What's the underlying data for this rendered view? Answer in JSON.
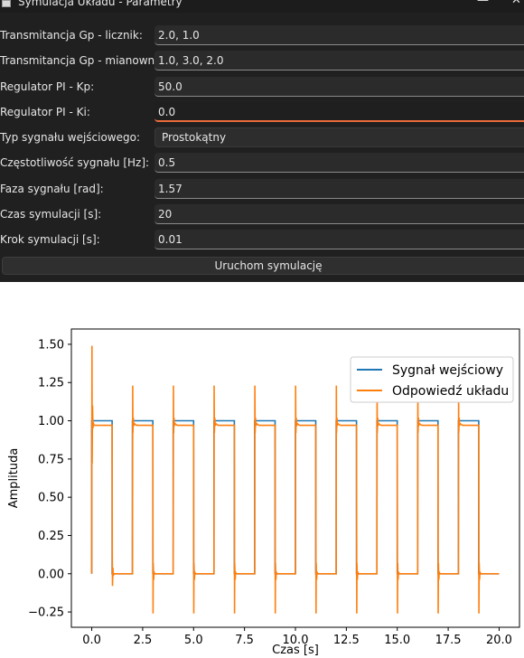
{
  "window": {
    "title": "Symulacja Układu - Parametry",
    "minimize_glyph": "—",
    "close_glyph": "✕"
  },
  "form": {
    "fields": [
      {
        "label": "Transmitancja Gp - licznik:",
        "value": "2.0, 1.0"
      },
      {
        "label": "Transmitancja Gp - mianownik:",
        "value": "1.0, 3.0, 2.0"
      },
      {
        "label": "Regulator PI - Kp:",
        "value": "50.0"
      },
      {
        "label": "Regulator PI - Ki:",
        "value": "0.0"
      },
      {
        "label": "Typ sygnału wejściowego:",
        "value": "Prostokątny"
      },
      {
        "label": "Częstotliwość sygnału [Hz]:",
        "value": "0.5"
      },
      {
        "label": "Faza sygnału [rad]:",
        "value": "1.57"
      },
      {
        "label": "Czas symulacji [s]:",
        "value": "20"
      },
      {
        "label": "Krok symulacji [s]:",
        "value": "0.01"
      }
    ],
    "run_button": "Uruchom symulację"
  },
  "chart_data": {
    "type": "line",
    "title": "",
    "xlabel": "Czas [s]",
    "ylabel": "Amplituda",
    "xlim": [
      -1.0,
      21.0
    ],
    "ylim": [
      -0.35,
      1.6
    ],
    "xticks": [
      0.0,
      2.5,
      5.0,
      7.5,
      10.0,
      12.5,
      15.0,
      17.5,
      20.0
    ],
    "xtick_labels": [
      "0.0",
      "2.5",
      "5.0",
      "7.5",
      "10.0",
      "12.5",
      "15.0",
      "17.5",
      "20.0"
    ],
    "yticks": [
      -0.25,
      0.0,
      0.25,
      0.5,
      0.75,
      1.0,
      1.25,
      1.5
    ],
    "ytick_labels": [
      "−0.25",
      "0.00",
      "0.25",
      "0.50",
      "0.75",
      "1.00",
      "1.25",
      "1.50"
    ],
    "grid": false,
    "legend_position": "top-right",
    "series": [
      {
        "name": "Sygnał wejściowy",
        "color": "#1f77b4",
        "x": [
          0,
          0.0,
          1.0,
          1.0,
          2.0,
          2.0,
          3.0,
          3.0,
          4.0,
          4.0,
          5.0,
          5.0,
          6.0,
          6.0,
          7.0,
          7.0,
          8.0,
          8.0,
          9.0,
          9.0,
          10.0,
          10.0,
          11.0,
          11.0,
          12.0,
          12.0,
          13.0,
          13.0,
          14.0,
          14.0,
          15.0,
          15.0,
          16.0,
          16.0,
          17.0,
          17.0,
          18.0,
          18.0,
          19.0,
          19.0,
          20.0
        ],
        "y": [
          0,
          1,
          1,
          0,
          0,
          1,
          1,
          0,
          0,
          1,
          1,
          0,
          0,
          1,
          1,
          0,
          0,
          1,
          1,
          0,
          0,
          1,
          1,
          0,
          0,
          1,
          1,
          0,
          0,
          1,
          1,
          0,
          0,
          1,
          1,
          0,
          0,
          1,
          1,
          0,
          0
        ]
      },
      {
        "name": "Odpowiedź układu",
        "color": "#ff7f0e",
        "x": [
          0.0,
          0.01,
          0.02,
          0.04,
          0.06,
          0.08,
          0.1,
          0.2,
          1.0,
          1.01,
          1.02,
          1.04,
          1.06,
          1.1,
          1.2,
          2.0,
          2.01,
          2.02,
          2.04,
          2.06,
          2.1,
          2.2,
          3.0,
          3.01,
          3.02,
          3.04,
          3.06,
          3.1,
          3.2,
          4.0,
          4.01,
          4.02,
          4.04,
          4.06,
          4.1,
          4.2,
          5.0,
          5.01,
          5.02,
          5.04,
          5.06,
          5.1,
          5.2,
          6.0,
          6.01,
          6.02,
          6.04,
          6.06,
          6.1,
          6.2,
          7.0,
          7.01,
          7.02,
          7.04,
          7.06,
          7.1,
          7.2,
          8.0,
          8.01,
          8.02,
          8.04,
          8.06,
          8.1,
          8.2,
          9.0,
          9.01,
          9.02,
          9.04,
          9.06,
          9.1,
          9.2,
          10.0,
          10.01,
          10.02,
          10.04,
          10.06,
          10.1,
          10.2,
          11.0,
          11.01,
          11.02,
          11.04,
          11.06,
          11.1,
          11.2,
          12.0,
          12.01,
          12.02,
          12.04,
          12.06,
          12.1,
          12.2,
          13.0,
          13.01,
          13.02,
          13.04,
          13.06,
          13.1,
          13.2,
          14.0,
          14.01,
          14.02,
          14.04,
          14.06,
          14.1,
          14.2,
          15.0,
          15.01,
          15.02,
          15.04,
          15.06,
          15.1,
          15.2,
          16.0,
          16.01,
          16.02,
          16.04,
          16.06,
          16.1,
          16.2,
          17.0,
          17.01,
          17.02,
          17.04,
          17.06,
          17.1,
          17.2,
          18.0,
          18.01,
          18.02,
          18.04,
          18.06,
          18.1,
          18.2,
          19.0,
          19.01,
          19.02,
          19.04,
          19.06,
          19.1,
          19.2,
          20.0
        ],
        "y": [
          0.0,
          1.49,
          0.72,
          1.1,
          0.95,
          0.99,
          0.97,
          0.97,
          0.97,
          0.12,
          -0.08,
          0.04,
          -0.01,
          0.0,
          0.0,
          0.0,
          1.23,
          0.92,
          1.02,
          0.97,
          0.98,
          0.97,
          0.97,
          -0.26,
          0.07,
          -0.04,
          0.01,
          0.0,
          0.0,
          0.0,
          1.23,
          0.92,
          1.02,
          0.97,
          0.98,
          0.97,
          0.97,
          -0.26,
          0.07,
          -0.04,
          0.01,
          0.0,
          0.0,
          0.0,
          1.23,
          0.92,
          1.02,
          0.97,
          0.98,
          0.97,
          0.97,
          -0.26,
          0.07,
          -0.04,
          0.01,
          0.0,
          0.0,
          0.0,
          1.23,
          0.92,
          1.02,
          0.97,
          0.98,
          0.97,
          0.97,
          -0.26,
          0.07,
          -0.04,
          0.01,
          0.0,
          0.0,
          0.0,
          1.23,
          0.92,
          1.02,
          0.97,
          0.98,
          0.97,
          0.97,
          -0.26,
          0.07,
          -0.04,
          0.01,
          0.0,
          0.0,
          0.0,
          1.23,
          0.92,
          1.02,
          0.97,
          0.98,
          0.97,
          0.97,
          -0.26,
          0.07,
          -0.04,
          0.01,
          0.0,
          0.0,
          0.0,
          1.23,
          0.92,
          1.02,
          0.97,
          0.98,
          0.97,
          0.97,
          -0.26,
          0.07,
          -0.04,
          0.01,
          0.0,
          0.0,
          0.0,
          1.23,
          0.92,
          1.02,
          0.97,
          0.98,
          0.97,
          0.97,
          -0.26,
          0.07,
          -0.04,
          0.01,
          0.0,
          0.0,
          0.0,
          1.23,
          0.92,
          1.02,
          0.97,
          0.98,
          0.97,
          0.97,
          -0.26,
          0.07,
          -0.04,
          0.01,
          0.0,
          0.0,
          0.0
        ]
      }
    ]
  }
}
